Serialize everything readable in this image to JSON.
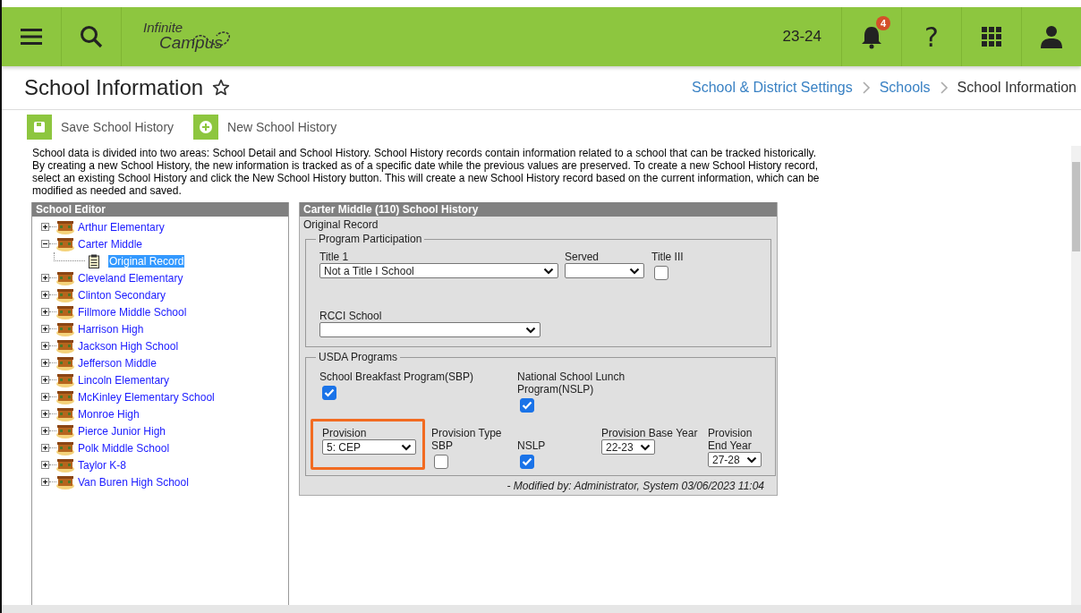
{
  "header": {
    "logo": {
      "top": "Infinite",
      "bottom": "Campus"
    },
    "year": "23-24",
    "notification_badge": "4",
    "help_label": "?"
  },
  "page": {
    "title": "School Information",
    "favorite": false,
    "breadcrumbs": [
      {
        "label": "School & District Settings",
        "kind": "link"
      },
      {
        "label": "Schools",
        "kind": "link"
      },
      {
        "label": "School Information",
        "kind": "current"
      }
    ]
  },
  "toolbar": [
    {
      "label": "Save School History",
      "kind": "save"
    },
    {
      "label": "New School History",
      "kind": "new"
    }
  ],
  "description": "School data is divided into two areas: School Detail and School History. School History records contain information related to a school that can be tracked historically. By creating a new School History, the new information is tracked as of a specific date while the previous values are preserved. To create a new School History record, select an existing School History and click the New School History button. This will create a new School History record based on the current information, which can be modified as needed and saved.",
  "tree": {
    "title": "School Editor",
    "items": [
      {
        "label": "Arthur Elementary",
        "kind": "school",
        "expanded": false,
        "selected": false
      },
      {
        "label": "Carter Middle",
        "kind": "school",
        "expanded": true,
        "selected": false,
        "children": [
          {
            "label": "Original Record",
            "kind": "record",
            "selected": true
          }
        ]
      },
      {
        "label": "Cleveland Elementary",
        "kind": "school",
        "expanded": false,
        "selected": false
      },
      {
        "label": "Clinton Secondary",
        "kind": "school",
        "expanded": false,
        "selected": false
      },
      {
        "label": "Fillmore Middle School",
        "kind": "school",
        "expanded": false,
        "selected": false
      },
      {
        "label": "Harrison High",
        "kind": "school",
        "expanded": false,
        "selected": false
      },
      {
        "label": "Jackson High School",
        "kind": "school",
        "expanded": false,
        "selected": false
      },
      {
        "label": "Jefferson Middle",
        "kind": "school",
        "expanded": false,
        "selected": false
      },
      {
        "label": "Lincoln Elementary",
        "kind": "school",
        "expanded": false,
        "selected": false
      },
      {
        "label": "McKinley Elementary School",
        "kind": "school",
        "expanded": false,
        "selected": false
      },
      {
        "label": "Monroe High",
        "kind": "school",
        "expanded": false,
        "selected": false
      },
      {
        "label": "Pierce Junior High",
        "kind": "school",
        "expanded": false,
        "selected": false
      },
      {
        "label": "Polk Middle School",
        "kind": "school",
        "expanded": false,
        "selected": false
      },
      {
        "label": "Taylor K-8",
        "kind": "school",
        "expanded": false,
        "selected": false
      },
      {
        "label": "Van Buren High School",
        "kind": "school",
        "expanded": false,
        "selected": false
      }
    ]
  },
  "history": {
    "title": "Carter Middle (110) School History",
    "record": "Original Record",
    "sections": [
      {
        "legend": "Program Participation",
        "kind": "program",
        "rows": [
          [
            {
              "kind": "select",
              "label": "Title 1",
              "value": "Not a Title I School"
            },
            {
              "kind": "select",
              "label": "Served"
            },
            {
              "kind": "checkbox",
              "label": "Title III",
              "checked": false
            }
          ],
          [
            {
              "kind": "select",
              "label": "RCCI School"
            }
          ]
        ]
      },
      {
        "legend": "USDA Programs",
        "kind": "usda",
        "rows": [
          [
            {
              "kind": "checkbox",
              "label": "School Breakfast Program(SBP)",
              "checked": true
            },
            "",
            {
              "kind": "checkbox",
              "label": "National School Lunch Program(NSLP)",
              "checked": true
            }
          ],
          [
            {
              "kind": "select",
              "label": "Provision",
              "value": "5: CEP",
              "highlighted": true
            },
            {
              "kind": "checkbox",
              "label": "Provision Type SBP",
              "checked": false
            },
            {
              "kind": "checkbox",
              "label": "NSLP",
              "checked": true
            },
            {
              "kind": "select",
              "label": "Provision Base Year",
              "value": "22-23"
            },
            {
              "kind": "select",
              "label": "Provision End Year",
              "value": "27-28"
            }
          ]
        ]
      }
    ],
    "modified": "- Modified by: Administrator, System 03/06/2023 11:04"
  }
}
